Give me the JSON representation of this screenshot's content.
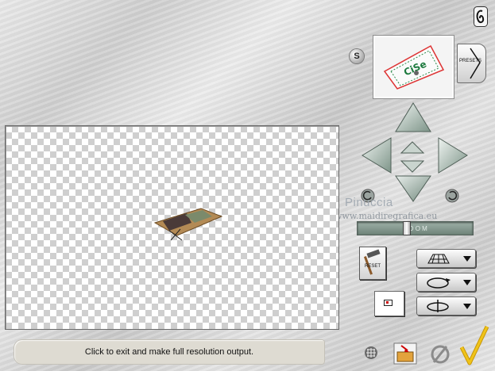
{
  "status_bar": {
    "text": "Click to exit and make full resolution output."
  },
  "buttons": {
    "s_label": "S",
    "presets_label": "PRESETS",
    "reset_label": "RESET"
  },
  "watermark": {
    "name": "Pinuccia",
    "url": "www.maidiregrafica.eu"
  },
  "zoom_slider": {
    "label": "Z O O M",
    "position": 0.42
  },
  "icons": [
    "clip-icon",
    "s-button-icon",
    "preset-thumbnail",
    "presets-arrow-icon",
    "arrow-up-icon",
    "arrow-down-icon",
    "arrow-left-icon",
    "arrow-right-icon",
    "nudge-up-icon",
    "nudge-down-icon",
    "rotate-left-icon",
    "rotate-right-icon",
    "hammer-icon",
    "perspective-grid-icon",
    "rotate-ellipse-icon",
    "spin-axis-icon",
    "grid-icon",
    "open-folder-icon",
    "cancel-icon",
    "confirm-check-icon"
  ],
  "colors": {
    "metal_light": "#e9e9e9",
    "metal_dark": "#c9c9c9",
    "checker": "#cfcfcf",
    "arrow_green": "#8fa69a",
    "confirm_yellow": "#f0c419"
  }
}
